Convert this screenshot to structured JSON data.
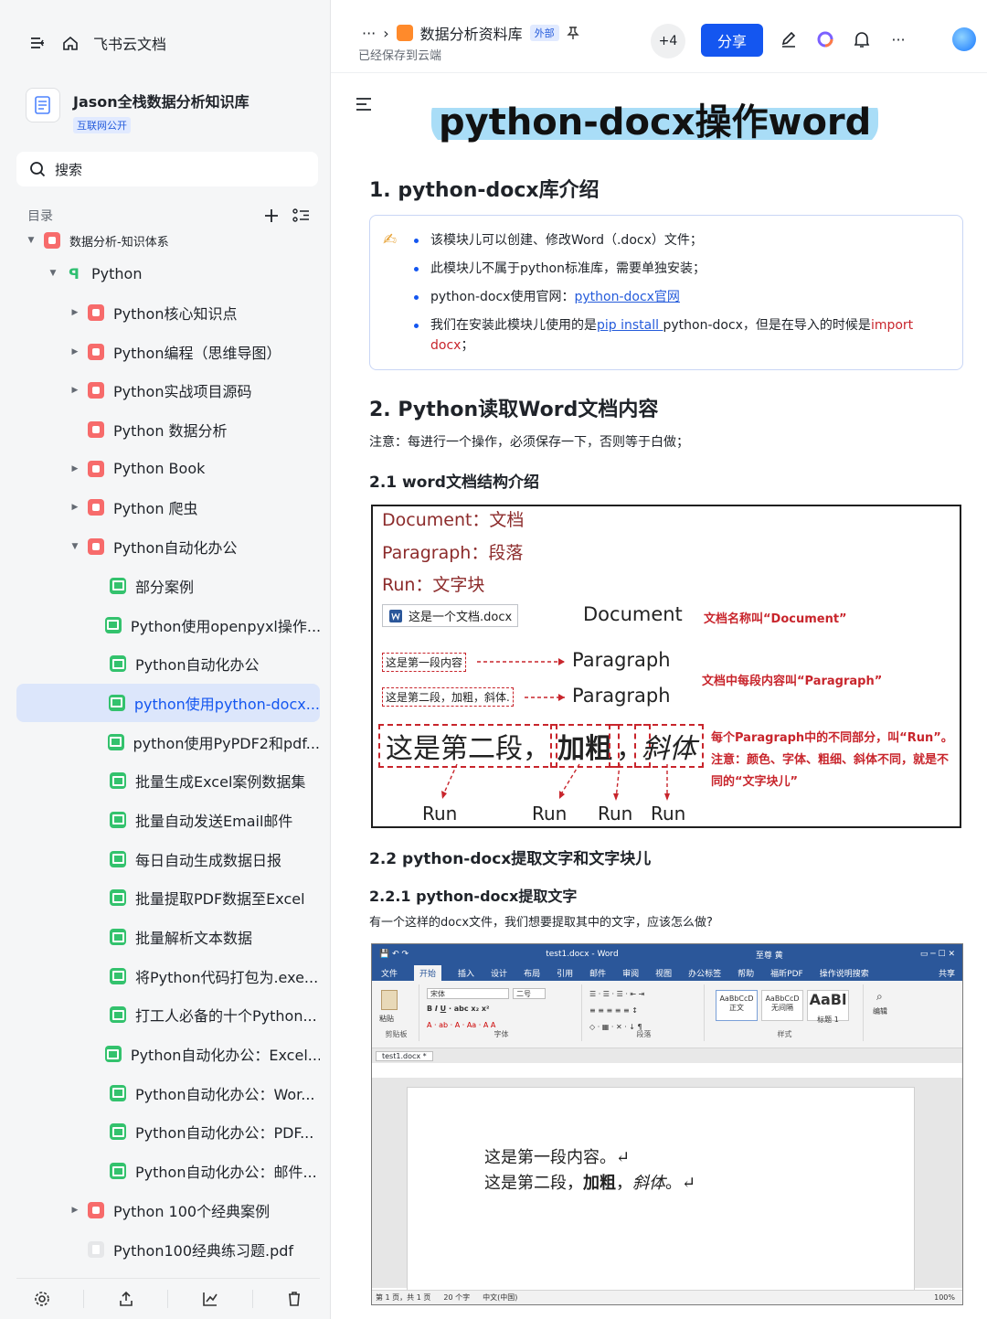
{
  "sidebar": {
    "app_name": "飞书云文档",
    "kb_title": "Jason全栈数据分析知识库",
    "kb_badge": "互联网公开",
    "search_label": "搜索",
    "toc_label": "目录",
    "tree": [
      {
        "label": "数据分析-知识体系",
        "depth": 0,
        "caret": "down",
        "icon": "red",
        "partial": true
      },
      {
        "label": "Python",
        "depth": 1,
        "caret": "down",
        "icon": "py"
      },
      {
        "label": "Python核心知识点",
        "depth": 2,
        "caret": "right",
        "icon": "red"
      },
      {
        "label": "Python编程（思维导图）",
        "depth": 2,
        "caret": "right",
        "icon": "red"
      },
      {
        "label": "Python实战项目源码",
        "depth": 2,
        "caret": "right",
        "icon": "red"
      },
      {
        "label": "Python 数据分析",
        "depth": 2,
        "caret": "none",
        "icon": "red"
      },
      {
        "label": "Python Book",
        "depth": 2,
        "caret": "right",
        "icon": "red"
      },
      {
        "label": "Python 爬虫",
        "depth": 2,
        "caret": "right",
        "icon": "red"
      },
      {
        "label": "Python自动化办公",
        "depth": 2,
        "caret": "down",
        "icon": "red"
      },
      {
        "label": "部分案例",
        "depth": 3,
        "caret": "none",
        "icon": "green"
      },
      {
        "label": "Python使用openpyxl操作...",
        "depth": 3,
        "caret": "none",
        "icon": "green"
      },
      {
        "label": "Python自动化办公",
        "depth": 3,
        "caret": "none",
        "icon": "green"
      },
      {
        "label": "python使用python-docx...",
        "depth": 3,
        "caret": "none",
        "icon": "green",
        "active": true
      },
      {
        "label": "python使用PyPDF2和pdf...",
        "depth": 3,
        "caret": "none",
        "icon": "green"
      },
      {
        "label": "批量生成Excel案例数据集",
        "depth": 3,
        "caret": "none",
        "icon": "green"
      },
      {
        "label": "批量自动发送Email邮件",
        "depth": 3,
        "caret": "none",
        "icon": "green"
      },
      {
        "label": "每日自动生成数据日报",
        "depth": 3,
        "caret": "none",
        "icon": "green"
      },
      {
        "label": "批量提取PDF数据至Excel",
        "depth": 3,
        "caret": "none",
        "icon": "green"
      },
      {
        "label": "批量解析文本数据",
        "depth": 3,
        "caret": "none",
        "icon": "green"
      },
      {
        "label": "将Python代码打包为.exe...",
        "depth": 3,
        "caret": "none",
        "icon": "green"
      },
      {
        "label": "打工人必备的十个Python...",
        "depth": 3,
        "caret": "none",
        "icon": "green"
      },
      {
        "label": "Python自动化办公：Excel...",
        "depth": 3,
        "caret": "none",
        "icon": "green"
      },
      {
        "label": "Python自动化办公：Wor...",
        "depth": 3,
        "caret": "none",
        "icon": "green"
      },
      {
        "label": "Python自动化办公：PDF...",
        "depth": 3,
        "caret": "none",
        "icon": "green"
      },
      {
        "label": "Python自动化办公：邮件...",
        "depth": 3,
        "caret": "none",
        "icon": "green"
      },
      {
        "label": "Python 100个经典案例",
        "depth": 2,
        "caret": "right",
        "icon": "red"
      },
      {
        "label": "Python100经典练习题.pdf",
        "depth": 2,
        "caret": "none",
        "icon": "pdf"
      }
    ]
  },
  "header": {
    "ellipsis": "···",
    "doc_name": "数据分析资料库",
    "external_badge": "外部",
    "saved_status": "已经保存到云端",
    "collaborators": "+4",
    "share_label": "分享",
    "more": "···"
  },
  "doc": {
    "title": "python-docx操作word",
    "h1_intro": "1. python-docx库介绍",
    "callout": {
      "item1": "该模块儿可以创建、修改Word（.docx）文件；",
      "item2": "此模块儿不属于python标准库，需要单独安装；",
      "item3_prefix": "python-docx使用官网：",
      "item3_link": "python-docx官网",
      "item4_a": "我们在安装此模块儿使用的是",
      "item4_link": "pip install ",
      "item4_b": "python-docx，但是在导入的时候是",
      "item4_c": "import docx",
      "item4_d": "；"
    },
    "h1_read": "2. Python读取Word文档内容",
    "note": "注意：每进行一个操作，必须保存一下，否则等于白做；",
    "h2_structure": "2.1 word文档结构介绍",
    "h2_extract": "2.2 python-docx提取文字和文字块儿",
    "h3_extract_text": "2.2.1 python-docx提取文字",
    "question": "有一个这样的docx文件，我们想要提取其中的文字，应该怎么做?"
  },
  "diagram": {
    "def_document": "Document：文档",
    "def_paragraph": "Paragraph：段落",
    "def_run": "Run：文字块",
    "file_chip": "这是一个文档.docx",
    "label_document": "Document",
    "note_document": "文档名称叫“Document”",
    "para1_box": "这是第一段内容",
    "para2_box": "这是第二段，加粗，斜体.",
    "label_paragraph": "Paragraph",
    "note_paragraph": "文档中每段内容叫“Paragraph”",
    "run1": "这是第二段，",
    "run2": "加粗",
    "run3": "，",
    "run4": "斜体",
    "note_run_1": "每个Paragraph中的不同部分，叫“Run”。",
    "note_run_2": "注意：颜色、字体、粗细、斜体不同，就是不",
    "note_run_3": "同的“文字块儿”",
    "run_label": "Run"
  },
  "word": {
    "window_title": "test1.docx  -  Word",
    "user": "至尊 黄",
    "tabs": [
      "文件",
      "开始",
      "插入",
      "设计",
      "布局",
      "引用",
      "邮件",
      "审阅",
      "视图",
      "办公标签",
      "帮助",
      "福昕PDF",
      "操作说明搜索"
    ],
    "share": "共享",
    "group_clipboard": "剪贴板",
    "group_font": "字体",
    "group_para": "段落",
    "group_styles": "样式",
    "group_edit": "编辑",
    "paste": "粘贴",
    "font_name": "宋体",
    "font_size": "二号",
    "style1": "AaBbCcD",
    "style1_name": "正文",
    "style2": "AaBbCcD",
    "style2_name": "无间隔",
    "style3": "AaBl",
    "style3_name": "标题 1",
    "doc_tab": "test1.docx *",
    "line1": "这是第一段内容。↵",
    "line2_a": "这是第二段，",
    "line2_b": "加粗",
    "line2_c": "，",
    "line2_d": "斜体",
    "line2_e": "。↵",
    "status_page": "第 1 页，共 1 页",
    "status_words": "20 个字",
    "status_lang": "中文(中国)",
    "status_zoom": "100%"
  }
}
